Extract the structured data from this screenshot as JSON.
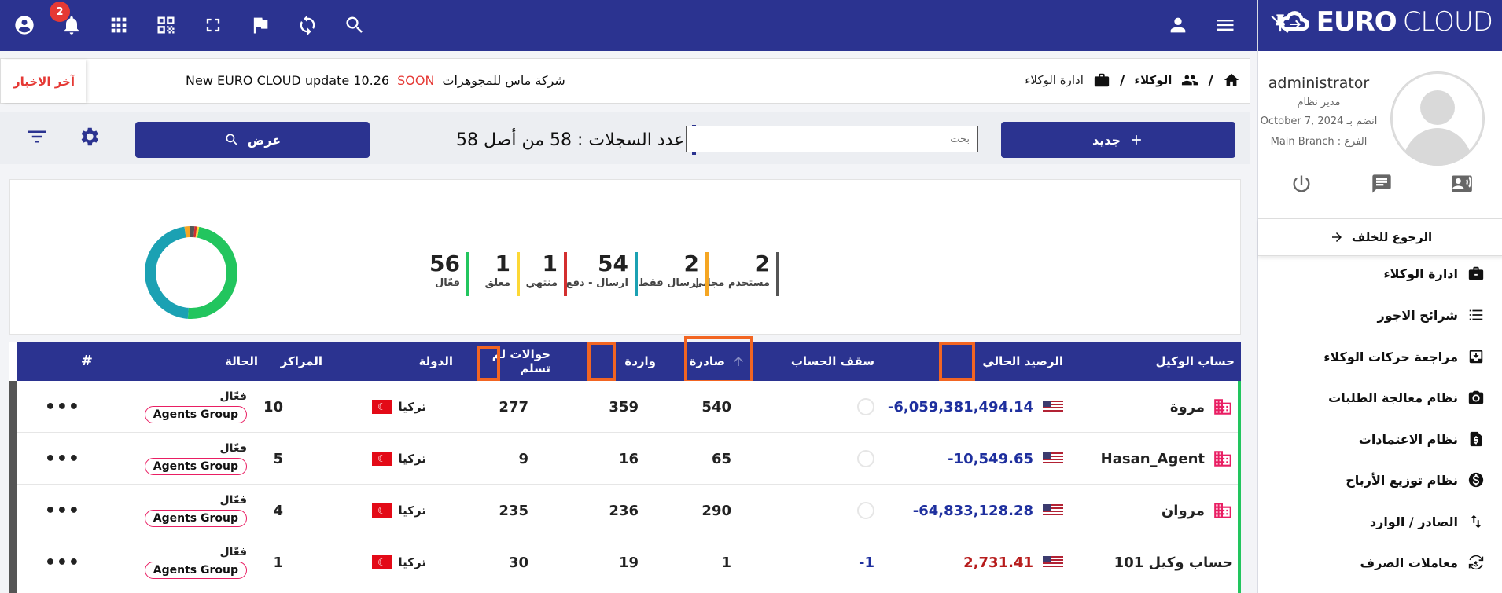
{
  "topbar": {
    "notification_count": "2",
    "icons": [
      "account-icon",
      "bell-icon",
      "apps-icon",
      "qr-icon",
      "fullscreen-icon",
      "flag-icon",
      "sync-icon",
      "search-icon",
      "person-icon",
      "menu-icon"
    ]
  },
  "brand": {
    "name_bold": "EURO",
    "name_light": "CLOUD"
  },
  "profile": {
    "username": "administrator",
    "role": "مدير نظام",
    "date_label": "October 7, 2024 انضم بـ",
    "branch": "Main Branch : الفرع"
  },
  "sidebar": {
    "back_label": "الرجوع للخلف",
    "items": [
      {
        "label": "ادارة الوكلاء",
        "icon": "briefcase-icon"
      },
      {
        "label": "شرائح الاجور",
        "icon": "list-icon"
      },
      {
        "label": "مراجعة حركات الوكلاء",
        "icon": "inbox-icon"
      },
      {
        "label": "نظام معالجة الطلبات",
        "icon": "camera-icon"
      },
      {
        "label": "نظام الاعتمادات",
        "icon": "dollar-doc-icon"
      },
      {
        "label": "نظام توزيع الأرباح",
        "icon": "coin-icon"
      },
      {
        "label": "الصادر / الوارد",
        "icon": "swap-vertical-icon"
      },
      {
        "label": "معاملات الصرف",
        "icon": "currency-exchange-icon"
      }
    ]
  },
  "news": {
    "tag": "آخر الاخبار",
    "company": "شركة ماس للمجوهرات",
    "soon": "SOON",
    "update": "New EURO CLOUD update 10.26"
  },
  "breadcrumb": {
    "agents": "الوكلاء",
    "current": "ادارة الوكلاء"
  },
  "toolbar": {
    "new_label": "جديد",
    "search_placeholder": "بحث",
    "count_text": "عدد السجلات : 58 من أصل 58",
    "view_label": "عرض"
  },
  "stats": [
    {
      "value": "2",
      "label": "مستخدم مجاني",
      "color": "#555555"
    },
    {
      "value": "2",
      "label": "ارسال فقط",
      "color": "#f5a623"
    },
    {
      "value": "54",
      "label": "ارسال - دفع",
      "color": "#1ba1b3"
    },
    {
      "value": "1",
      "label": "منتهي",
      "color": "#d32f2f"
    },
    {
      "value": "1",
      "label": "معلق",
      "color": "#fdd835"
    },
    {
      "value": "56",
      "label": "فعّال",
      "color": "#22c55e"
    }
  ],
  "table": {
    "headers": {
      "agent": "حساب الوكيل",
      "balance": "الرصيد الحالي",
      "limit": "سقف الحساب",
      "outgoing": "صادرة",
      "incoming": "واردة",
      "unreceived": "حوالات لم تسلم",
      "country": "الدولة",
      "centers": "المراكز",
      "status": "الحالة",
      "hash": "#"
    },
    "rows": [
      {
        "agent": "مروة",
        "balance": "-6,059,381,494.14",
        "limit": "",
        "outgoing": "540",
        "incoming": "359",
        "unreceived": "277",
        "country": "تركيا",
        "centers": "10",
        "status": "فعّال",
        "group": "Agents Group",
        "more": "•••"
      },
      {
        "agent": "Hasan_Agent",
        "balance": "-10,549.65",
        "limit": "",
        "outgoing": "65",
        "incoming": "16",
        "unreceived": "9",
        "country": "تركيا",
        "centers": "5",
        "status": "فعّال",
        "group": "Agents Group",
        "more": "•••"
      },
      {
        "agent": "مروان",
        "balance": "-64,833,128.28",
        "limit": "",
        "outgoing": "290",
        "incoming": "236",
        "unreceived": "235",
        "country": "تركيا",
        "centers": "4",
        "status": "فعّال",
        "group": "Agents Group",
        "more": "•••"
      },
      {
        "agent": "حساب وكيل 101",
        "balance": "2,731.41",
        "limit": "-1",
        "outgoing": "1",
        "incoming": "19",
        "unreceived": "30",
        "country": "تركيا",
        "centers": "1",
        "status": "فعّال",
        "group": "Agents Group",
        "more": "•••"
      }
    ]
  }
}
